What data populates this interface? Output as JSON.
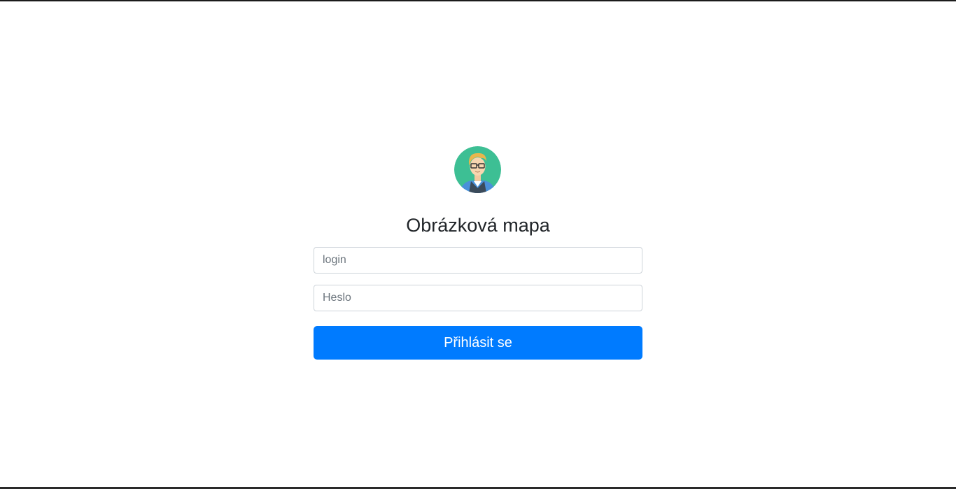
{
  "page": {
    "title": "Obrázková mapa"
  },
  "avatar": {
    "icon": "user-avatar-icon",
    "background_color": "#3dbf94"
  },
  "form": {
    "login_placeholder": "login",
    "login_value": "",
    "password_placeholder": "Heslo",
    "password_value": "",
    "submit_label": "Přihlásit se",
    "accent_color": "#007bff"
  }
}
